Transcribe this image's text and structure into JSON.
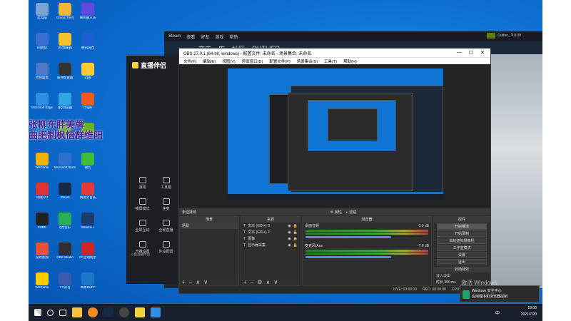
{
  "desktop": {
    "icons": [
      {
        "label": "此电脑",
        "color": "#7aa3d6"
      },
      {
        "label": "Grand Theft",
        "color": "#f2b63b"
      },
      {
        "label": "搜狗输入法",
        "color": "#5d4be0"
      },
      {
        "label": "回收站",
        "color": "#3a6ed1"
      },
      {
        "label": "UU加速器",
        "color": "#f6c22b"
      },
      {
        "label": "腾讯游戏",
        "color": "#1c5fd3"
      },
      {
        "label": "控制面板",
        "color": "#4d79c7"
      },
      {
        "label": "雷神加速器",
        "color": "#333"
      },
      {
        "label": "迅雷",
        "color": "#ffcc33"
      },
      {
        "label": "Microsoft Edge",
        "color": "#2f8fe4"
      },
      {
        "label": "QQ浏览器",
        "color": "#2fa7e6"
      },
      {
        "label": "Origin",
        "color": "#f05a22"
      },
      {
        "label": "腾讯QQ",
        "color": "#0a8cd9"
      },
      {
        "label": "Geforce",
        "color": "#6bb43f"
      },
      {
        "label": "Nvidia",
        "color": "#69b224"
      },
      {
        "label": "WeGame",
        "color": "#f0b400"
      },
      {
        "label": "Microsoft Store",
        "color": "#2f6fd0"
      },
      {
        "label": "微信",
        "color": "#3fbd3a"
      },
      {
        "label": "网易UU",
        "color": "#d33"
      },
      {
        "label": "Steam",
        "color": "#152a47"
      },
      {
        "label": "网易云音乐",
        "color": "#e33b3b"
      },
      {
        "label": "PUBG",
        "color": "#222"
      },
      {
        "label": "QQ音乐",
        "color": "#27b057"
      },
      {
        "label": "Steam++",
        "color": "#193c6a"
      },
      {
        "label": "游戏加加",
        "color": "#e9513e"
      },
      {
        "label": "OBS Studio",
        "color": "#302e31"
      },
      {
        "label": "CF活动助手",
        "color": "#cf2525"
      },
      {
        "label": "WeGame",
        "color": "#ffcc00"
      },
      {
        "label": "YY语音",
        "color": "#3b5ab0"
      },
      {
        "label": "网易BUFF",
        "color": "#1d77c9"
      }
    ],
    "overlay_line1": "张柳东胖美牌",
    "overlay_line2": "曲肥制枫悟群维阳"
  },
  "steam": {
    "top_items": [
      "Steam",
      "查看",
      "好友",
      "游戏",
      "帮助"
    ],
    "nav_items": [
      "商店",
      "库",
      "社区",
      "OUTLIER"
    ],
    "account": "Outlier_ ¥ 0.00"
  },
  "live_assistant": {
    "title": "直播伴侣",
    "tiles": [
      "游戏",
      "工具箱",
      "横屏模式",
      "连麦",
      "全屏互动",
      "全景直播",
      "开播设置",
      "外设配置"
    ],
    "footer": "斗鱼直播伴侣"
  },
  "obs": {
    "title": "OBS 27.0.1 (64-bit, windows) - 配置文件: 未命名 - 场景集合: 未命名",
    "menu": [
      "文件(F)",
      "编辑(E)",
      "视图(V)",
      "停靠窗口(D)",
      "配置文件(P)",
      "场景集合(S)",
      "工具(T)",
      "帮助(H)"
    ],
    "no_source": "未选择源",
    "props_btn": "属性",
    "filter_btn": "滤镜",
    "docks": {
      "scenes_title": "场景",
      "scenes": [
        "场景"
      ],
      "sources_title": "来源",
      "sources": [
        "文本 (GDI+) 3",
        "文本 (GDI+) 2",
        "图像",
        "显示器采集"
      ],
      "mixer_title": "混音器",
      "mixer": [
        {
          "name": "桌面音频",
          "db": "0.0 dB"
        },
        {
          "name": "麦克风/Aux",
          "db": "-7.6 dB"
        }
      ],
      "trans_title": "转场特效",
      "trans_type": "淡入淡出",
      "trans_dur": "时长 300 ms",
      "controls_title": "控件",
      "controls": [
        "开始推流",
        "开始录制",
        "启动虚拟摄像机",
        "工作室模式",
        "设置",
        "退出"
      ]
    },
    "status": [
      "LIVE: 00:00:00",
      "REC: 00:00:00",
      "CPU: 1.9%, 60.00 fps"
    ]
  },
  "windows": {
    "activate1": "激活 Windows",
    "activate2": "转到\"设置\"以激活 Windows。",
    "notif1": "Windows 安全中心",
    "notif2": "应用程序和浏览器控制",
    "time": "19:00",
    "date": "2021/7/20",
    "ime": "中"
  }
}
